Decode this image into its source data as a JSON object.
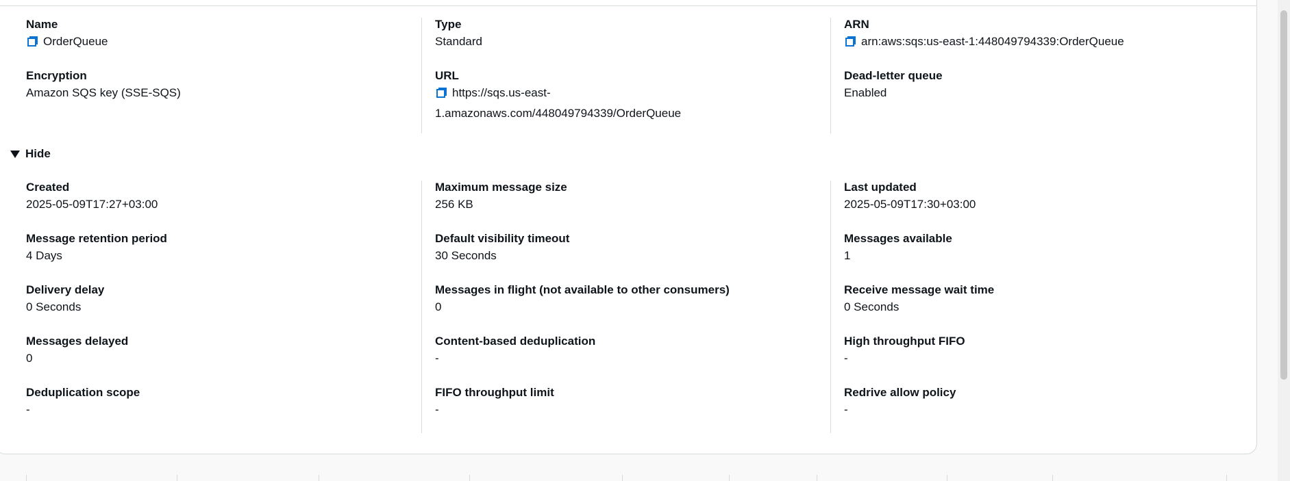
{
  "summary": {
    "name": {
      "label": "Name",
      "value": "OrderQueue"
    },
    "type": {
      "label": "Type",
      "value": "Standard"
    },
    "arn": {
      "label": "ARN",
      "value": "arn:aws:sqs:us-east-1:448049794339:OrderQueue"
    },
    "encryption": {
      "label": "Encryption",
      "value": "Amazon SQS key (SSE-SQS)"
    },
    "url": {
      "label": "URL",
      "value_line1": "https://sqs.us-east-",
      "value_line2": "1.amazonaws.com/448049794339/OrderQueue"
    },
    "dead_letter_queue": {
      "label": "Dead-letter queue",
      "value": "Enabled"
    }
  },
  "toggle": {
    "label": "Hide",
    "icon": "caret-down-icon"
  },
  "details": {
    "created": {
      "label": "Created",
      "value": "2025-05-09T17:27+03:00"
    },
    "max_message_size": {
      "label": "Maximum message size",
      "value": "256 KB"
    },
    "last_updated": {
      "label": "Last updated",
      "value": "2025-05-09T17:30+03:00"
    },
    "retention": {
      "label": "Message retention period",
      "value": "4 Days"
    },
    "visibility_timeout": {
      "label": "Default visibility timeout",
      "value": "30 Seconds"
    },
    "messages_available": {
      "label": "Messages available",
      "value": "1"
    },
    "delivery_delay": {
      "label": "Delivery delay",
      "value": "0 Seconds"
    },
    "messages_in_flight": {
      "label": "Messages in flight (not available to other consumers)",
      "value": "0"
    },
    "receive_wait_time": {
      "label": "Receive message wait time",
      "value": "0 Seconds"
    },
    "messages_delayed": {
      "label": "Messages delayed",
      "value": "0"
    },
    "content_dedup": {
      "label": "Content-based deduplication",
      "value": "-"
    },
    "high_throughput_fifo": {
      "label": "High throughput FIFO",
      "value": "-"
    },
    "dedup_scope": {
      "label": "Deduplication scope",
      "value": "-"
    },
    "fifo_throughput_limit": {
      "label": "FIFO throughput limit",
      "value": "-"
    },
    "redrive_allow_policy": {
      "label": "Redrive allow policy",
      "value": "-"
    }
  },
  "colors": {
    "accent": "#0972d3",
    "text": "#0f141a",
    "border": "#d5dbdb",
    "background": "#ffffff",
    "page_background": "#f9f9f9"
  }
}
